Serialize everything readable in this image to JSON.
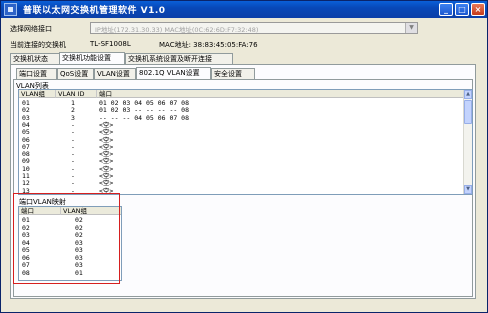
{
  "window": {
    "title": "普联以太网交换机管理软件 V1.0",
    "minimize": "_",
    "maximize": "□",
    "close": "×"
  },
  "connection": {
    "select_label": "选择网络接口",
    "select_value": "IP地址(172.31.30.33)   MAC地址(0C:62:6D:F7:32:48)",
    "current_label": "当前连接的交换机",
    "switch_model": "TL-SF1008L",
    "mac_label": "MAC地址: 38:83:45:05:FA:76"
  },
  "top_tabs": [
    {
      "label": "交换机状态"
    },
    {
      "label": "交换机功能设置"
    },
    {
      "label": "交换机系统设置及断开连接"
    }
  ],
  "sub_tabs": [
    {
      "label": "端口设置"
    },
    {
      "label": "QoS设置"
    },
    {
      "label": "VLAN设置"
    },
    {
      "label": "802.1Q VLAN设置"
    },
    {
      "label": "安全设置"
    }
  ],
  "vlan_list": {
    "title": "VLAN列表",
    "columns": [
      "VLAN组",
      "VLAN ID",
      "端口"
    ],
    "rows": [
      {
        "group": "01",
        "id": "1",
        "ports": "01 02 03 04 05 06 07 08"
      },
      {
        "group": "02",
        "id": "2",
        "ports": "01 02 03 -- -- -- -- 08"
      },
      {
        "group": "03",
        "id": "3",
        "ports": "-- -- -- 04 05 06 07 08"
      },
      {
        "group": "04",
        "id": "-",
        "ports": "<空>"
      },
      {
        "group": "05",
        "id": "-",
        "ports": "<空>"
      },
      {
        "group": "06",
        "id": "-",
        "ports": "<空>"
      },
      {
        "group": "07",
        "id": "-",
        "ports": "<空>"
      },
      {
        "group": "08",
        "id": "-",
        "ports": "<空>"
      },
      {
        "group": "09",
        "id": "-",
        "ports": "<空>"
      },
      {
        "group": "10",
        "id": "-",
        "ports": "<空>"
      },
      {
        "group": "11",
        "id": "-",
        "ports": "<空>"
      },
      {
        "group": "12",
        "id": "-",
        "ports": "<空>"
      },
      {
        "group": "13",
        "id": "-",
        "ports": "<空>"
      }
    ]
  },
  "port_mapping": {
    "title": "端口VLAN映射",
    "columns": [
      "端口",
      "VLAN组"
    ],
    "rows": [
      {
        "port": "01",
        "group": "02"
      },
      {
        "port": "02",
        "group": "02"
      },
      {
        "port": "03",
        "group": "02"
      },
      {
        "port": "04",
        "group": "03"
      },
      {
        "port": "05",
        "group": "03"
      },
      {
        "port": "06",
        "group": "03"
      },
      {
        "port": "07",
        "group": "03"
      },
      {
        "port": "08",
        "group": "01"
      }
    ]
  },
  "colors": {
    "titlebar": "#0848b8",
    "highlight_box": "#d61f1f",
    "window_bg": "#ece9d8"
  }
}
